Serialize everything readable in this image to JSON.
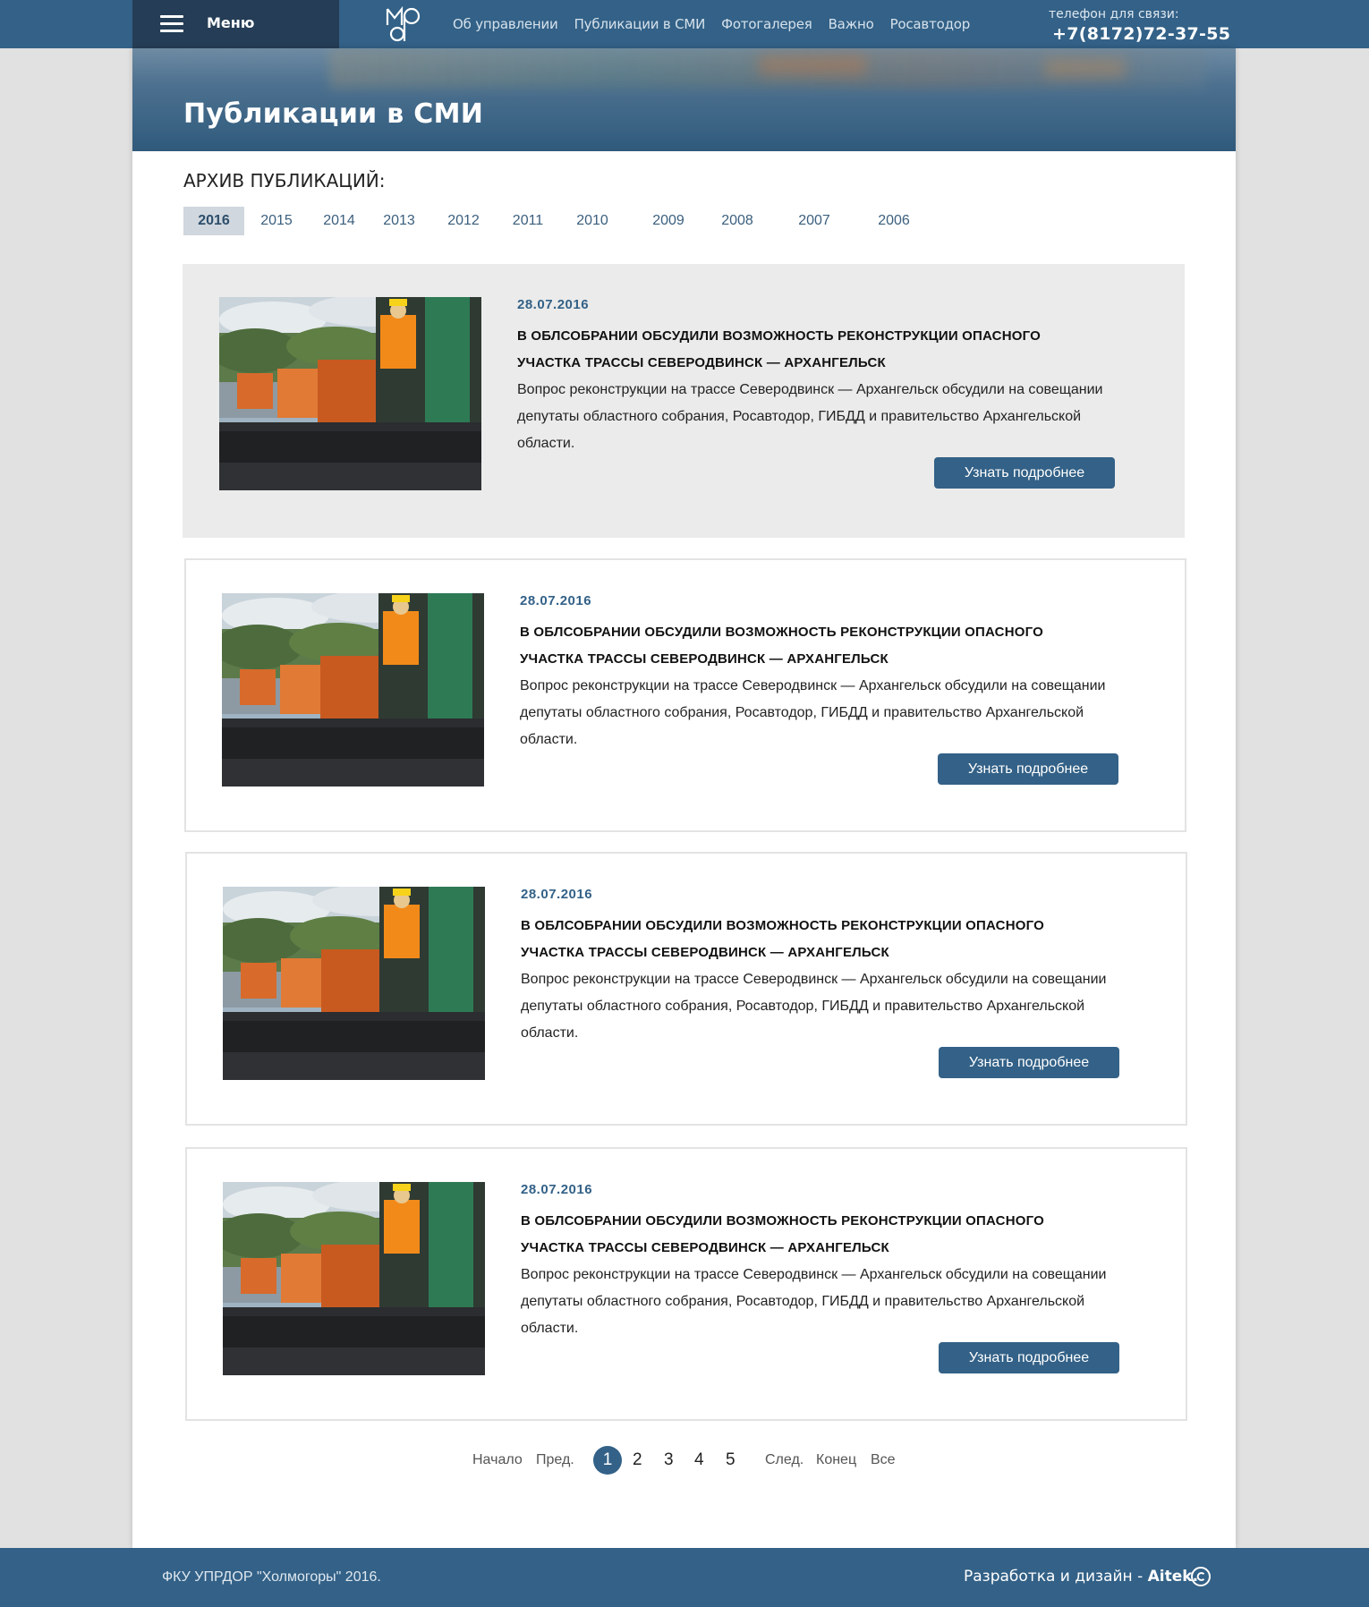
{
  "header": {
    "menu_label": "Меню",
    "nav": [
      "Об управлении",
      "Публикации в СМИ",
      "Фотогалерея",
      "Важно",
      "Росавтодор"
    ],
    "phone_caption": "телефон для связи:",
    "phone_number": "+7(8172)72-37-55"
  },
  "hero": {
    "title": "Публикации в СМИ"
  },
  "archive": {
    "title": "АРХИВ ПУБЛИКАЦИЙ:",
    "years": [
      "2016",
      "2015",
      "2014",
      "2013",
      "2012",
      "2011",
      "2010",
      "2009",
      "2008",
      "2007",
      "2006"
    ],
    "active_year": "2016"
  },
  "articles": [
    {
      "date": "28.07.2016",
      "title": "В ОБЛСОБРАНИИ ОБСУДИЛИ ВОЗМОЖНОСТЬ РЕКОНСТРУКЦИИ ОПАСНОГО УЧАСТКА ТРАССЫ СЕВЕРОДВИНСК — АРХАНГЕЛЬСК",
      "text": "Вопрос реконструкции на трассе Северодвинск — Архангельск обсудили на совещании депутаты областного собрания, Росавтодор, ГИБДД и правительство Архангельской области.",
      "button": "Узнать подробнее"
    },
    {
      "date": "28.07.2016",
      "title": "В ОБЛСОБРАНИИ ОБСУДИЛИ ВОЗМОЖНОСТЬ РЕКОНСТРУКЦИИ ОПАСНОГО УЧАСТКА ТРАССЫ СЕВЕРОДВИНСК — АРХАНГЕЛЬСК",
      "text": "Вопрос реконструкции на трассе Северодвинск — Архангельск обсудили на совещании депутаты областного собрания, Росавтодор, ГИБДД и правительство Архангельской области.",
      "button": "Узнать подробнее"
    },
    {
      "date": "28.07.2016",
      "title": "В ОБЛСОБРАНИИ ОБСУДИЛИ ВОЗМОЖНОСТЬ РЕКОНСТРУКЦИИ ОПАСНОГО УЧАСТКА ТРАССЫ СЕВЕРОДВИНСК — АРХАНГЕЛЬСК",
      "text": "Вопрос реконструкции на трассе Северодвинск — Архангельск обсудили на совещании депутаты областного собрания, Росавтодор, ГИБДД и правительство Архангельской области.",
      "button": "Узнать подробнее"
    },
    {
      "date": "28.07.2016",
      "title": "В ОБЛСОБРАНИИ ОБСУДИЛИ ВОЗМОЖНОСТЬ РЕКОНСТРУКЦИИ ОПАСНОГО УЧАСТКА ТРАССЫ СЕВЕРОДВИНСК — АРХАНГЕЛЬСК",
      "text": "Вопрос реконструкции на трассе Северодвинск — Архангельск обсудили на совещании депутаты областного собрания, Росавтодор, ГИБДД и правительство Архангельской области.",
      "button": "Узнать подробнее"
    }
  ],
  "pagination": {
    "first": "Начало",
    "prev": "Пред.",
    "pages": [
      "1",
      "2",
      "3",
      "4",
      "5"
    ],
    "current": "1",
    "next": "След.",
    "last": "Конец",
    "all": "Все"
  },
  "footer": {
    "left": "ФКУ УПРДОР \"Холмогоры\" 2016.",
    "right_prefix": "Разработка и дизайн - ",
    "right_brand": "Aitek."
  },
  "colors": {
    "primary": "#336187",
    "menu_dark": "#253d56",
    "active_year_bg": "#d0d7de"
  }
}
